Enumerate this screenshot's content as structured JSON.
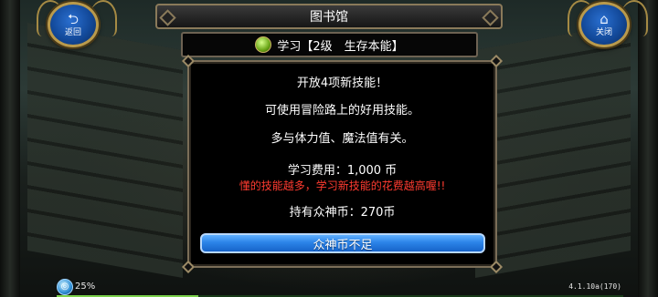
{
  "window": {
    "title": "图书馆"
  },
  "nav": {
    "back": {
      "icon": "return-arrow-icon",
      "label": "返回"
    },
    "close": {
      "icon": "home-icon",
      "label": "关闭"
    }
  },
  "skill": {
    "icon": "skill-gem-icon",
    "header": "学习【2级　生存本能】"
  },
  "panel": {
    "lines": [
      "开放4项新技能！",
      "可使用冒险路上的好用技能。",
      "多与体力值、魔法值有关。"
    ],
    "cost_line": "学习费用：1,000 币",
    "warning": "懂的技能越多，学习新技能的花费越高喔!!",
    "coins_line": "持有众神币：270币",
    "action_button": "众神币不足"
  },
  "status": {
    "percent_text": "25%",
    "progress_fraction": 0.25,
    "version": "4.1.10a(170)"
  },
  "colors": {
    "button_blue": "#2c84e8",
    "warning_red": "#ff3b30",
    "frame_gold": "#b99a4c"
  }
}
